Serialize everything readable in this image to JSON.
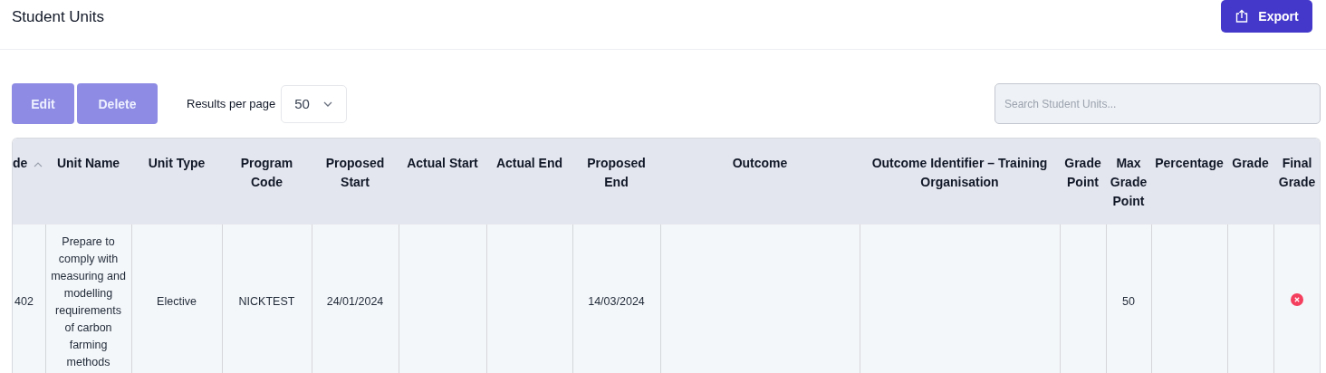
{
  "page": {
    "title": "Student Units",
    "export_button": "Export"
  },
  "toolbar": {
    "buttons": [
      {
        "label": "Edit",
        "disabled": true
      },
      {
        "label": "Delete",
        "disabled": true
      }
    ],
    "results_label": "Results per page",
    "results_value": "50",
    "search": {
      "placeholder": "Search Student Units..."
    }
  },
  "table": {
    "columns": [
      {
        "label": "de",
        "sorted": true
      },
      {
        "label": "Unit Name",
        "sorted": false
      },
      {
        "label": "Unit Type",
        "sorted": false
      },
      {
        "label": "Program Code",
        "sorted": false
      },
      {
        "label": "Proposed Start",
        "sorted": false
      },
      {
        "label": "Actual Start",
        "sorted": false
      },
      {
        "label": "Actual End",
        "sorted": false
      },
      {
        "label": "Proposed End",
        "sorted": false
      },
      {
        "label": "Outcome",
        "sorted": false
      },
      {
        "label": "Outcome Identifier – Training Organisation",
        "sorted": false
      },
      {
        "label": "Grade Point",
        "sorted": false
      },
      {
        "label": "Max Grade Point",
        "sorted": false
      },
      {
        "label": "Percentage",
        "sorted": false
      },
      {
        "label": "Grade",
        "sorted": false
      },
      {
        "label": "Final Grade",
        "sorted": false
      }
    ],
    "rows": [
      {
        "cells": [
          "402",
          "Prepare to comply with measuring and modelling requirements of carbon farming methods",
          "Elective",
          "NICKTEST",
          "24/01/2024",
          null,
          null,
          "14/03/2024",
          null,
          null,
          null,
          "50",
          null,
          null
        ],
        "final_grade_passed": false
      }
    ]
  }
}
